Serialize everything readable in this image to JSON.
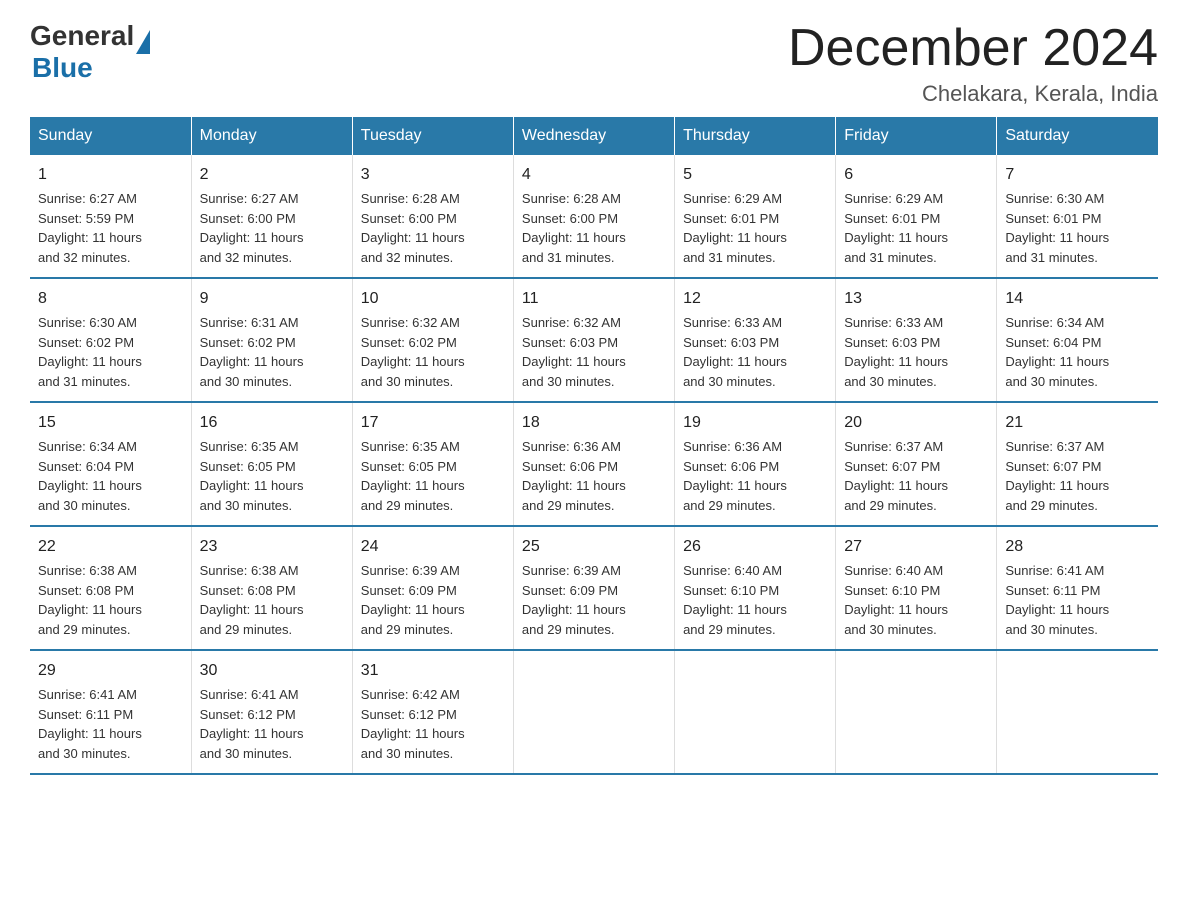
{
  "logo": {
    "general": "General",
    "blue": "Blue"
  },
  "title": "December 2024",
  "subtitle": "Chelakara, Kerala, India",
  "days_of_week": [
    "Sunday",
    "Monday",
    "Tuesday",
    "Wednesday",
    "Thursday",
    "Friday",
    "Saturday"
  ],
  "weeks": [
    [
      {
        "day": "1",
        "info": "Sunrise: 6:27 AM\nSunset: 5:59 PM\nDaylight: 11 hours\nand 32 minutes."
      },
      {
        "day": "2",
        "info": "Sunrise: 6:27 AM\nSunset: 6:00 PM\nDaylight: 11 hours\nand 32 minutes."
      },
      {
        "day": "3",
        "info": "Sunrise: 6:28 AM\nSunset: 6:00 PM\nDaylight: 11 hours\nand 32 minutes."
      },
      {
        "day": "4",
        "info": "Sunrise: 6:28 AM\nSunset: 6:00 PM\nDaylight: 11 hours\nand 31 minutes."
      },
      {
        "day": "5",
        "info": "Sunrise: 6:29 AM\nSunset: 6:01 PM\nDaylight: 11 hours\nand 31 minutes."
      },
      {
        "day": "6",
        "info": "Sunrise: 6:29 AM\nSunset: 6:01 PM\nDaylight: 11 hours\nand 31 minutes."
      },
      {
        "day": "7",
        "info": "Sunrise: 6:30 AM\nSunset: 6:01 PM\nDaylight: 11 hours\nand 31 minutes."
      }
    ],
    [
      {
        "day": "8",
        "info": "Sunrise: 6:30 AM\nSunset: 6:02 PM\nDaylight: 11 hours\nand 31 minutes."
      },
      {
        "day": "9",
        "info": "Sunrise: 6:31 AM\nSunset: 6:02 PM\nDaylight: 11 hours\nand 30 minutes."
      },
      {
        "day": "10",
        "info": "Sunrise: 6:32 AM\nSunset: 6:02 PM\nDaylight: 11 hours\nand 30 minutes."
      },
      {
        "day": "11",
        "info": "Sunrise: 6:32 AM\nSunset: 6:03 PM\nDaylight: 11 hours\nand 30 minutes."
      },
      {
        "day": "12",
        "info": "Sunrise: 6:33 AM\nSunset: 6:03 PM\nDaylight: 11 hours\nand 30 minutes."
      },
      {
        "day": "13",
        "info": "Sunrise: 6:33 AM\nSunset: 6:03 PM\nDaylight: 11 hours\nand 30 minutes."
      },
      {
        "day": "14",
        "info": "Sunrise: 6:34 AM\nSunset: 6:04 PM\nDaylight: 11 hours\nand 30 minutes."
      }
    ],
    [
      {
        "day": "15",
        "info": "Sunrise: 6:34 AM\nSunset: 6:04 PM\nDaylight: 11 hours\nand 30 minutes."
      },
      {
        "day": "16",
        "info": "Sunrise: 6:35 AM\nSunset: 6:05 PM\nDaylight: 11 hours\nand 30 minutes."
      },
      {
        "day": "17",
        "info": "Sunrise: 6:35 AM\nSunset: 6:05 PM\nDaylight: 11 hours\nand 29 minutes."
      },
      {
        "day": "18",
        "info": "Sunrise: 6:36 AM\nSunset: 6:06 PM\nDaylight: 11 hours\nand 29 minutes."
      },
      {
        "day": "19",
        "info": "Sunrise: 6:36 AM\nSunset: 6:06 PM\nDaylight: 11 hours\nand 29 minutes."
      },
      {
        "day": "20",
        "info": "Sunrise: 6:37 AM\nSunset: 6:07 PM\nDaylight: 11 hours\nand 29 minutes."
      },
      {
        "day": "21",
        "info": "Sunrise: 6:37 AM\nSunset: 6:07 PM\nDaylight: 11 hours\nand 29 minutes."
      }
    ],
    [
      {
        "day": "22",
        "info": "Sunrise: 6:38 AM\nSunset: 6:08 PM\nDaylight: 11 hours\nand 29 minutes."
      },
      {
        "day": "23",
        "info": "Sunrise: 6:38 AM\nSunset: 6:08 PM\nDaylight: 11 hours\nand 29 minutes."
      },
      {
        "day": "24",
        "info": "Sunrise: 6:39 AM\nSunset: 6:09 PM\nDaylight: 11 hours\nand 29 minutes."
      },
      {
        "day": "25",
        "info": "Sunrise: 6:39 AM\nSunset: 6:09 PM\nDaylight: 11 hours\nand 29 minutes."
      },
      {
        "day": "26",
        "info": "Sunrise: 6:40 AM\nSunset: 6:10 PM\nDaylight: 11 hours\nand 29 minutes."
      },
      {
        "day": "27",
        "info": "Sunrise: 6:40 AM\nSunset: 6:10 PM\nDaylight: 11 hours\nand 30 minutes."
      },
      {
        "day": "28",
        "info": "Sunrise: 6:41 AM\nSunset: 6:11 PM\nDaylight: 11 hours\nand 30 minutes."
      }
    ],
    [
      {
        "day": "29",
        "info": "Sunrise: 6:41 AM\nSunset: 6:11 PM\nDaylight: 11 hours\nand 30 minutes."
      },
      {
        "day": "30",
        "info": "Sunrise: 6:41 AM\nSunset: 6:12 PM\nDaylight: 11 hours\nand 30 minutes."
      },
      {
        "day": "31",
        "info": "Sunrise: 6:42 AM\nSunset: 6:12 PM\nDaylight: 11 hours\nand 30 minutes."
      },
      {
        "day": "",
        "info": ""
      },
      {
        "day": "",
        "info": ""
      },
      {
        "day": "",
        "info": ""
      },
      {
        "day": "",
        "info": ""
      }
    ]
  ]
}
